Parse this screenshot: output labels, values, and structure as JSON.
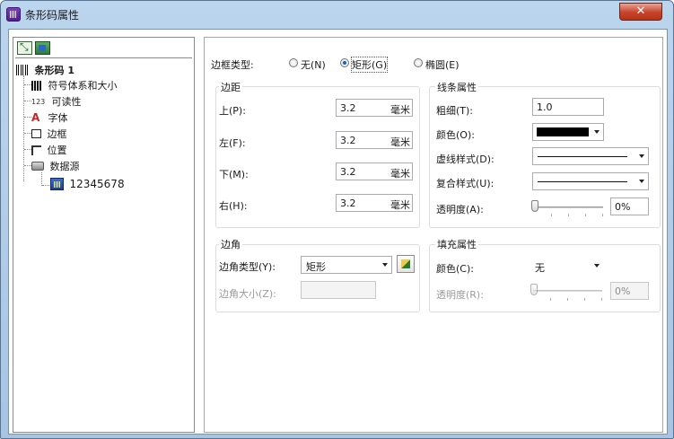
{
  "window": {
    "title": "条形码属性",
    "close_label": "✕"
  },
  "tree": {
    "root": "条形码 1",
    "items": [
      {
        "label": "符号体系和大小",
        "icon": "barcode-bars-icon"
      },
      {
        "label": "可读性",
        "icon": "readability-123-icon",
        "icon_text": "123"
      },
      {
        "label": "字体",
        "icon": "font-icon",
        "icon_text": "A"
      },
      {
        "label": "边框",
        "icon": "border-icon"
      },
      {
        "label": "位置",
        "icon": "position-icon"
      },
      {
        "label": "数据源",
        "icon": "datasource-icon"
      }
    ],
    "datasource_value": "12345678"
  },
  "border_type": {
    "label": "边框类型:",
    "options": [
      "无(N)",
      "矩形(G)",
      "椭圆(E)"
    ],
    "selected": "矩形(G)"
  },
  "margins": {
    "title": "边距",
    "rows": [
      {
        "label": "上(P):",
        "value": "3.2",
        "unit": "毫米"
      },
      {
        "label": "左(F):",
        "value": "3.2",
        "unit": "毫米"
      },
      {
        "label": "下(M):",
        "value": "3.2",
        "unit": "毫米"
      },
      {
        "label": "右(H):",
        "value": "3.2",
        "unit": "毫米"
      }
    ]
  },
  "line_props": {
    "title": "线条属性",
    "thickness_label": "粗细(T):",
    "thickness_value": "1.0",
    "color_label": "颜色(O):",
    "color_value": "#000000",
    "dash_label": "虚线样式(D):",
    "compound_label": "复合样式(U):",
    "transparency_label": "透明度(A):",
    "transparency_value": "0%",
    "transparency_level": 0
  },
  "corner": {
    "title": "边角",
    "type_label": "边角类型(Y):",
    "type_value": "矩形",
    "size_label": "边角大小(Z):"
  },
  "fill": {
    "title": "填充属性",
    "color_label": "颜色(C):",
    "color_value": "无",
    "transparency_label": "透明度(R):",
    "transparency_value": "0%",
    "transparency_level": 0
  }
}
